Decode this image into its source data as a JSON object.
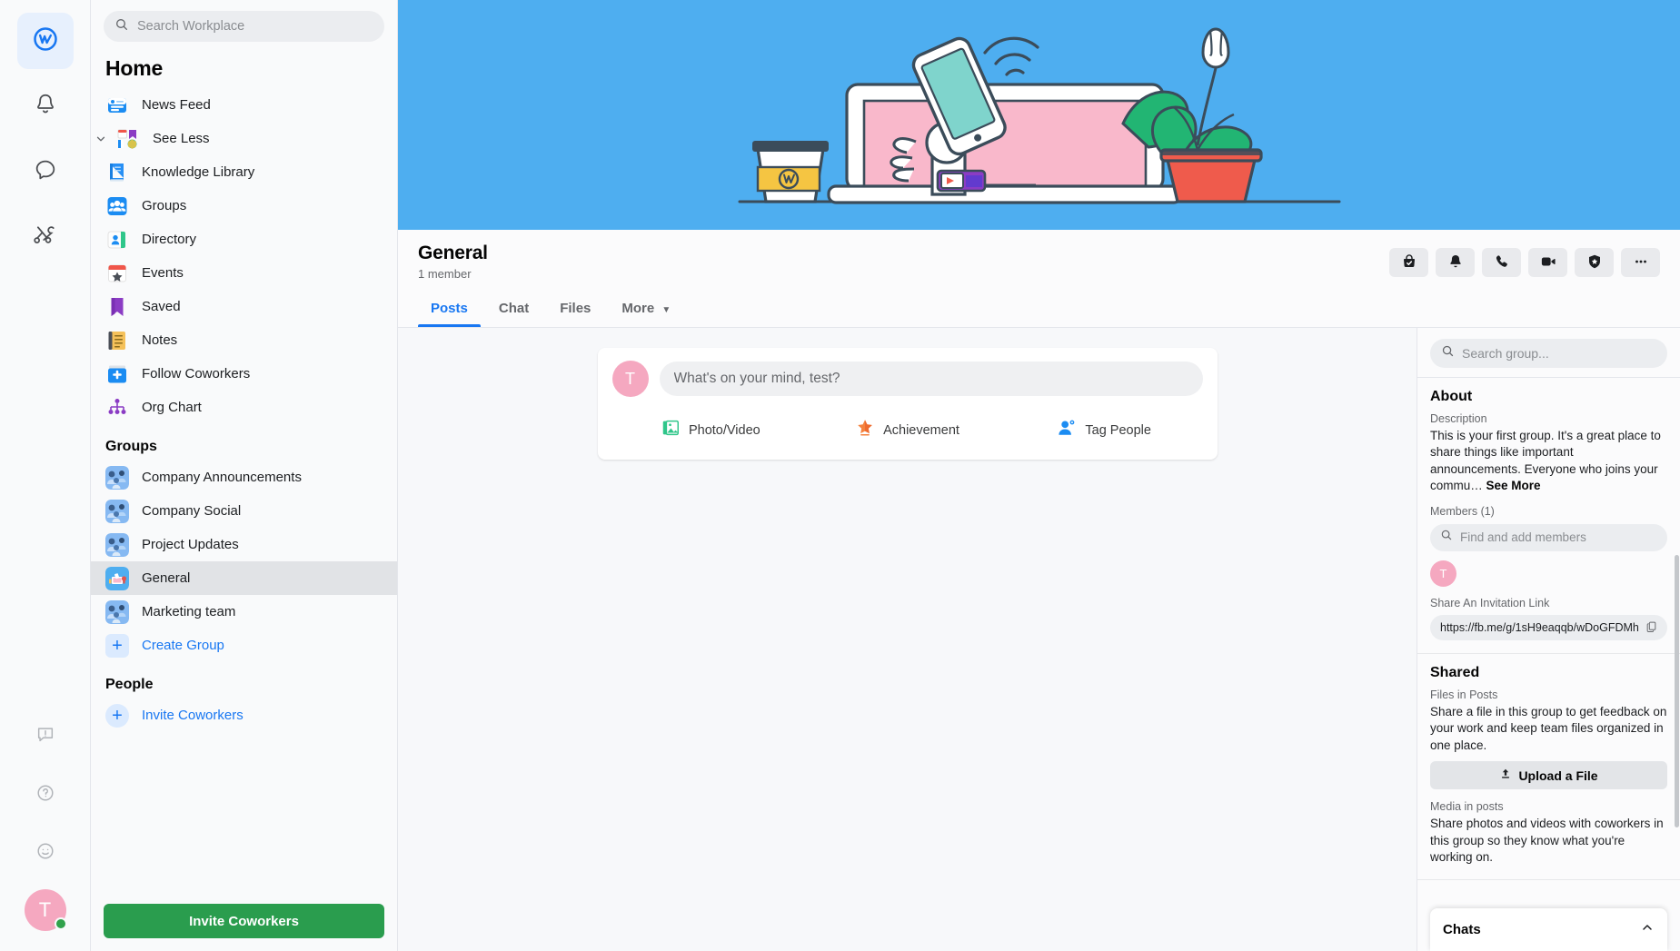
{
  "rail": {
    "items": [
      {
        "name": "workplace-home",
        "icon": "workplace-logo-icon",
        "active": true
      },
      {
        "name": "notifications",
        "icon": "bell-icon",
        "active": false
      },
      {
        "name": "chat",
        "icon": "chat-bubble-icon",
        "active": false
      },
      {
        "name": "tools",
        "icon": "tools-icon",
        "active": false
      }
    ],
    "bottom": [
      {
        "name": "feedback",
        "icon": "feedback-icon"
      },
      {
        "name": "help",
        "icon": "question-circle-icon"
      },
      {
        "name": "emoji",
        "icon": "smiley-icon"
      }
    ],
    "avatar_initial": "T",
    "status": "online"
  },
  "search": {
    "placeholder": "Search Workplace",
    "value": ""
  },
  "sidebar": {
    "title": "Home",
    "nav": [
      {
        "label": "News Feed",
        "icon": "news-feed-icon",
        "caret": false
      },
      {
        "label": "See Less",
        "icon": "see-less-icon",
        "caret": true
      },
      {
        "label": "Knowledge Library",
        "icon": "knowledge-library-icon",
        "caret": false
      },
      {
        "label": "Groups",
        "icon": "groups-icon",
        "caret": false
      },
      {
        "label": "Directory",
        "icon": "directory-icon",
        "caret": false
      },
      {
        "label": "Events",
        "icon": "events-icon",
        "caret": false
      },
      {
        "label": "Saved",
        "icon": "saved-bookmark-icon",
        "caret": false
      },
      {
        "label": "Notes",
        "icon": "notes-icon",
        "caret": false
      },
      {
        "label": "Follow Coworkers",
        "icon": "follow-coworkers-icon",
        "caret": false
      },
      {
        "label": "Org Chart",
        "icon": "org-chart-icon",
        "caret": false
      }
    ],
    "groups_header": "Groups",
    "groups": [
      {
        "label": "Company Announcements",
        "selected": false
      },
      {
        "label": "Company Social",
        "selected": false
      },
      {
        "label": "Project Updates",
        "selected": false
      },
      {
        "label": "General",
        "selected": true
      },
      {
        "label": "Marketing team",
        "selected": false
      }
    ],
    "create_group": "Create Group",
    "people_header": "People",
    "invite_coworkers_link": "Invite Coworkers",
    "invite_button": "Invite Coworkers"
  },
  "group": {
    "name": "General",
    "member_count": "1 member",
    "actions": [
      {
        "name": "joined-button",
        "icon": "bag-check-icon"
      },
      {
        "name": "notifications-button",
        "icon": "bell-icon"
      },
      {
        "name": "call-button",
        "icon": "phone-icon"
      },
      {
        "name": "video-call-button",
        "icon": "video-camera-icon"
      },
      {
        "name": "safety-button",
        "icon": "shield-star-icon"
      },
      {
        "name": "more-options-button",
        "icon": "ellipsis-icon"
      }
    ],
    "tabs": [
      {
        "label": "Posts",
        "active": true,
        "dropdown": false
      },
      {
        "label": "Chat",
        "active": false,
        "dropdown": false
      },
      {
        "label": "Files",
        "active": false,
        "dropdown": false
      },
      {
        "label": "More",
        "active": false,
        "dropdown": true
      }
    ]
  },
  "composer": {
    "avatar_initial": "T",
    "placeholder": "What's on your mind, test?",
    "value": "",
    "actions": [
      {
        "label": "Photo/Video",
        "icon": "photo-video-icon"
      },
      {
        "label": "Achievement",
        "icon": "achievement-star-icon"
      },
      {
        "label": "Tag People",
        "icon": "tag-people-icon"
      }
    ]
  },
  "right": {
    "search_placeholder": "Search group...",
    "search_value": "",
    "about": {
      "heading": "About",
      "description_label": "Description",
      "description": "This is your first group. It's a great place to share things like important announcements. Everyone who joins your commu…",
      "see_more": "See More",
      "members_label": "Members (1)",
      "find_placeholder": "Find and add members",
      "member_avatar_initial": "T",
      "invite_label": "Share An Invitation Link",
      "invite_url": "https://fb.me/g/1sH9eaqqb/wDoGFDMh"
    },
    "shared": {
      "heading": "Shared",
      "files_label": "Files in Posts",
      "files_text": "Share a file in this group to get feedback on your work and keep team files organized in one place.",
      "upload_button": "Upload a File",
      "media_label": "Media in posts",
      "media_text": "Share photos and videos with coworkers in this group so they know what you're working on."
    },
    "chats": {
      "title": "Chats",
      "collapse_icon": "chevron-up-icon"
    }
  },
  "colors": {
    "accent": "#1877f2",
    "cover": "#4eaef0",
    "green": "#2a9d4e",
    "avatar_pink": "#f5a8c0",
    "online": "#31a24c"
  }
}
